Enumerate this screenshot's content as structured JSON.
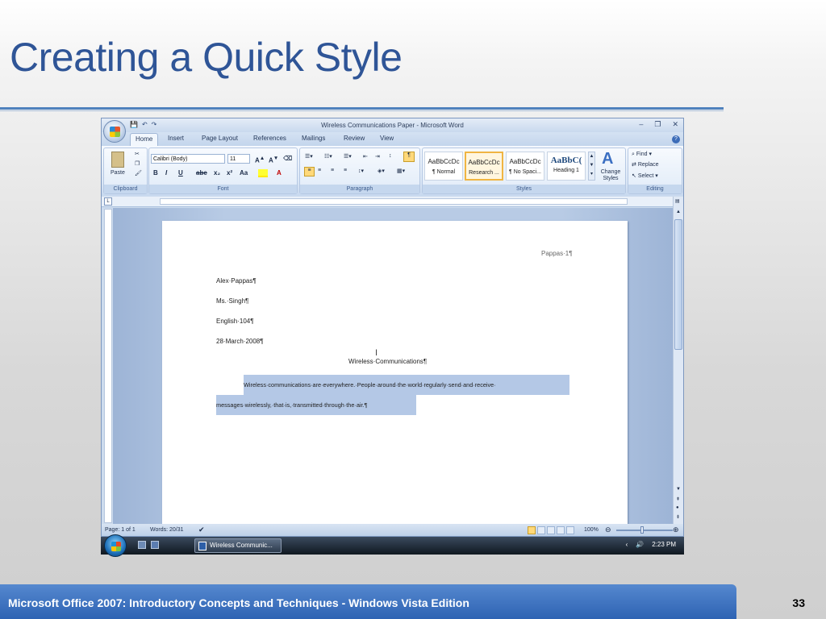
{
  "slide": {
    "title": "Creating a Quick Style",
    "footer": "Microsoft Office 2007: Introductory Concepts and Techniques - Windows Vista Edition",
    "number": "33"
  },
  "word": {
    "window_title": "Wireless Communications Paper - Microsoft Word",
    "tabs": [
      "Home",
      "Insert",
      "Page Layout",
      "References",
      "Mailings",
      "Review",
      "View"
    ],
    "clipboard": {
      "paste": "Paste",
      "label": "Clipboard"
    },
    "font": {
      "name": "Calibri (Body)",
      "size": "11",
      "label": "Font",
      "buttons": [
        "B",
        "I",
        "U",
        "abe",
        "x₂",
        "x²",
        "Aa"
      ]
    },
    "paragraph": {
      "label": "Paragraph"
    },
    "styles": {
      "label": "Styles",
      "items": [
        {
          "sample": "AaBbCcDc",
          "name": "¶ Normal"
        },
        {
          "sample": "AaBbCcDc",
          "name": "Research ..."
        },
        {
          "sample": "AaBbCcDc",
          "name": "¶ No Spaci..."
        },
        {
          "sample": "AaBbC(",
          "name": "Heading 1"
        }
      ],
      "change": "Change Styles"
    },
    "editing": {
      "label": "Editing",
      "find": "Find",
      "replace": "Replace",
      "select": "Select"
    },
    "document": {
      "header": "Pappas·1¶",
      "lines": [
        "Alex·Pappas¶",
        "Ms.·Singh¶",
        "English·104¶",
        "28·March·2008¶"
      ],
      "doc_title": "Wireless·Communications¶",
      "body1": "Wireless·communications·are·everywhere.·People·around·the·world·regularly·send·and·receive·",
      "body2": "messages·wirelessly,·that·is,·transmitted·through·the·air.¶"
    },
    "status": {
      "page": "Page: 1 of 1",
      "words": "Words: 20/31",
      "zoom": "100%"
    }
  },
  "taskbar": {
    "item": "Wireless Communic...",
    "time": "2:23 PM"
  }
}
